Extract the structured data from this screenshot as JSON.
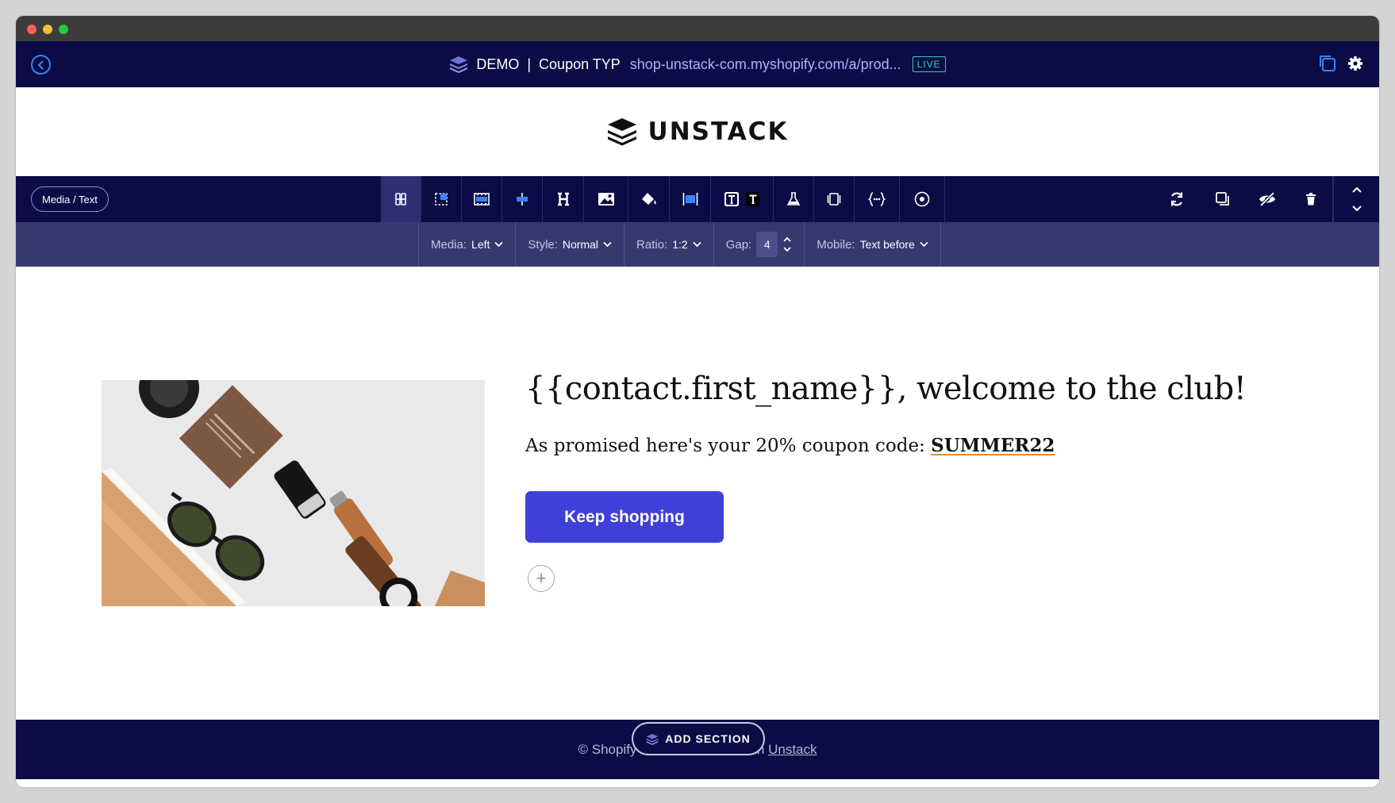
{
  "header": {
    "title": "DEMO",
    "separator": "|",
    "page_name": "Coupon TYP",
    "url": "shop-unstack-com.myshopify.com/a/prod...",
    "status_badge": "LIVE"
  },
  "brand": {
    "name": "UNSTACK"
  },
  "toolbar": {
    "section_label": "Media / Text",
    "tools": [
      "layout-icon",
      "crop-icon",
      "film-strip-icon",
      "align-center-icon",
      "heading-icon",
      "image-icon",
      "paint-bucket-icon",
      "width-icon",
      "text-style-box-icon",
      "text-style-icon",
      "lab-flask-icon",
      "frame-icon",
      "code-variable-icon",
      "target-icon"
    ],
    "right_tools": [
      "refresh-icon",
      "duplicate-icon",
      "hide-icon",
      "trash-icon",
      "move-updown-icon"
    ]
  },
  "options": {
    "media_label": "Media:",
    "media_value": "Left",
    "style_label": "Style:",
    "style_value": "Normal",
    "ratio_label": "Ratio:",
    "ratio_value": "1:2",
    "gap_label": "Gap:",
    "gap_value": "4",
    "mobile_label": "Mobile:",
    "mobile_value": "Text before"
  },
  "content": {
    "headline": "{{contact.first_name}}, welcome to the club!",
    "subline_prefix": "As promised here's your 20% coupon code: ",
    "coupon_code": "SUMMER22",
    "cta_label": "Keep shopping",
    "add_block": "+"
  },
  "footer": {
    "text_prefix": "© Shopify",
    "text_suffix": "th",
    "link": "Unstack",
    "add_section": "ADD SECTION"
  },
  "colors": {
    "navy": "#0b0c45",
    "sub_toolbar": "#36396e",
    "cta": "#3f3fd9",
    "live": "#2dd4bf",
    "coupon_underline": "#e58a2e"
  }
}
